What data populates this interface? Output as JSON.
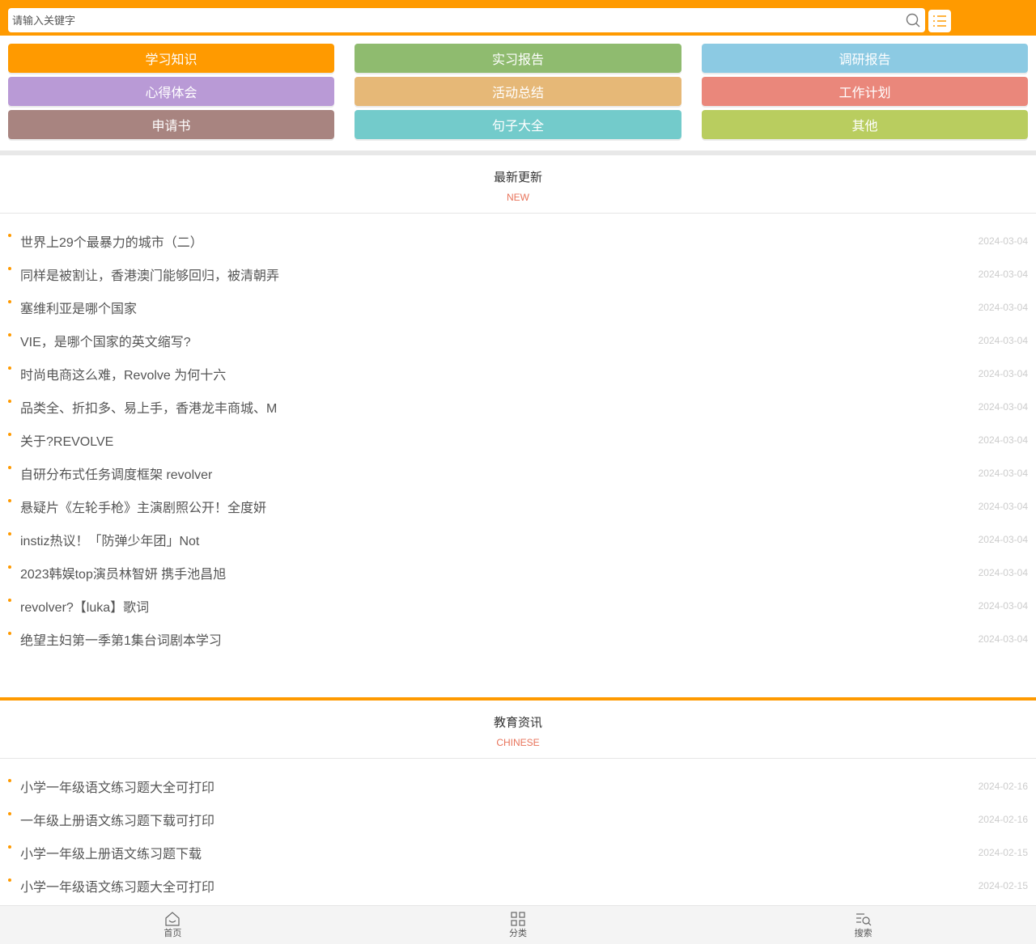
{
  "search": {
    "placeholder": "请输入关键字"
  },
  "categories": [
    {
      "label": "学习知识",
      "color": "#ff9a00"
    },
    {
      "label": "实习报告",
      "color": "#8fbb6f"
    },
    {
      "label": "调研报告",
      "color": "#8ccae3"
    },
    {
      "label": "心得体会",
      "color": "#b99ad6"
    },
    {
      "label": "活动总结",
      "color": "#e6b877"
    },
    {
      "label": "工作计划",
      "color": "#ea877b"
    },
    {
      "label": "申请书",
      "color": "#a88480"
    },
    {
      "label": "句子大全",
      "color": "#73cbcb"
    },
    {
      "label": "其他",
      "color": "#b9cd5f"
    }
  ],
  "latest": {
    "title": "最新更新",
    "subtitle": "NEW",
    "items": [
      {
        "title": "世界上29个最暴力的城市（二）",
        "date": "2024-03-04"
      },
      {
        "title": "同样是被割让，香港澳门能够回归，被清朝弄",
        "date": "2024-03-04"
      },
      {
        "title": "塞维利亚是哪个国家",
        "date": "2024-03-04"
      },
      {
        "title": "VIE，是哪个国家的英文缩写?",
        "date": "2024-03-04"
      },
      {
        "title": "时尚电商这么难，Revolve 为何十六",
        "date": "2024-03-04"
      },
      {
        "title": "品类全、折扣多、易上手，香港龙丰商城、M",
        "date": "2024-03-04"
      },
      {
        "title": "关于?REVOLVE",
        "date": "2024-03-04"
      },
      {
        "title": "自研分布式任务调度框架 revolver",
        "date": "2024-03-04"
      },
      {
        "title": "悬疑片《左轮手枪》主演剧照公开！全度妍",
        "date": "2024-03-04"
      },
      {
        "title": "instiz热议！「防弹少年团」Not",
        "date": "2024-03-04"
      },
      {
        "title": "2023韩娱top演员林智妍 携手池昌旭",
        "date": "2024-03-04"
      },
      {
        "title": "revolver?【luka】歌词",
        "date": "2024-03-04"
      },
      {
        "title": "绝望主妇第一季第1集台词剧本学习",
        "date": "2024-03-04"
      }
    ]
  },
  "education": {
    "title": "教育资讯",
    "subtitle": "CHINESE",
    "items": [
      {
        "title": "小学一年级语文练习题大全可打印",
        "date": "2024-02-16"
      },
      {
        "title": "一年级上册语文练习题下载可打印",
        "date": "2024-02-16"
      },
      {
        "title": "小学一年级上册语文练习题下载",
        "date": "2024-02-15"
      },
      {
        "title": "小学一年级语文练习题大全可打印",
        "date": "2024-02-15"
      }
    ]
  },
  "nav": [
    {
      "label": "首页",
      "icon": "home-icon"
    },
    {
      "label": "分类",
      "icon": "grid-icon"
    },
    {
      "label": "搜索",
      "icon": "search-list-icon"
    }
  ]
}
